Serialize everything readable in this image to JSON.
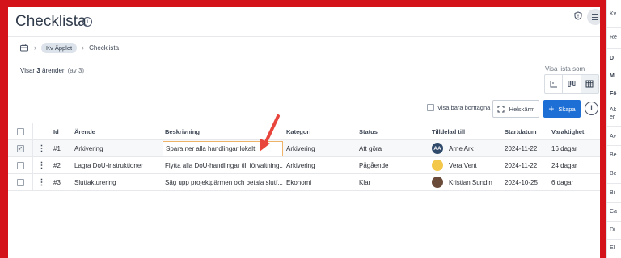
{
  "header": {
    "title": "Checklista",
    "info_icon": "info-icon",
    "shield_icon": "shield-icon",
    "menu_icon": "hamburger-icon"
  },
  "breadcrumb": {
    "home_icon": "briefcase-icon",
    "project": "Kv Äpplet",
    "current": "Checklista"
  },
  "summary": {
    "prefix": "Visar",
    "count": "3",
    "label": "ärenden",
    "total": "(av 3)"
  },
  "view": {
    "label": "Visa lista som",
    "options": [
      "gantt-chart-icon",
      "board-icon",
      "table-icon"
    ],
    "selected": "table-icon"
  },
  "toolbar": {
    "only_deleted_label": "Visa bara borttagna",
    "fullscreen_label": "Helskärm",
    "create_label": "Skapa"
  },
  "table": {
    "columns": [
      "Id",
      "Ärende",
      "Beskrivning",
      "Kategori",
      "Status",
      "Tilldelad till",
      "Startdatum",
      "Varaktighet"
    ],
    "rows": [
      {
        "id": "#1",
        "arende": "Arkivering",
        "beskrivning": "Spara ner alla handlingar lokalt",
        "kategori": "Arkivering",
        "status": "Att göra",
        "initials": "AA",
        "tilldelad": "Arne Ark",
        "start": "2024-11-22",
        "varaktighet": "16 dagar",
        "checked": true,
        "editing": true
      },
      {
        "id": "#2",
        "arende": "Lagra DoU-instruktioner",
        "beskrivning": "Flytta alla DoU-handlingar till förvaltning...",
        "kategori": "Arkivering",
        "status": "Pågående",
        "initials": "",
        "tilldelad": "Vera Vent",
        "start": "2024-11-22",
        "varaktighet": "24 dagar",
        "checked": false
      },
      {
        "id": "#3",
        "arende": "Slutfakturering",
        "beskrivning": "Säg upp projektpärmen och betala slutf...",
        "kategori": "Ekonomi",
        "status": "Klar",
        "initials": "",
        "tilldelad": "Kristian Sundin",
        "start": "2024-10-25",
        "varaktighet": "6 dagar",
        "checked": false
      }
    ]
  },
  "side_strip": {
    "items": [
      "Kv",
      "Re",
      "D",
      "M",
      "Fö",
      "Ak",
      "er",
      "Av",
      "Be",
      "Be",
      "Bi",
      "Ca",
      "Di",
      "El"
    ]
  },
  "colors": {
    "frame": "#d4121a",
    "primary": "#1d6fd6",
    "edit_border": "#f0b36a",
    "arrow": "#e8453c"
  }
}
